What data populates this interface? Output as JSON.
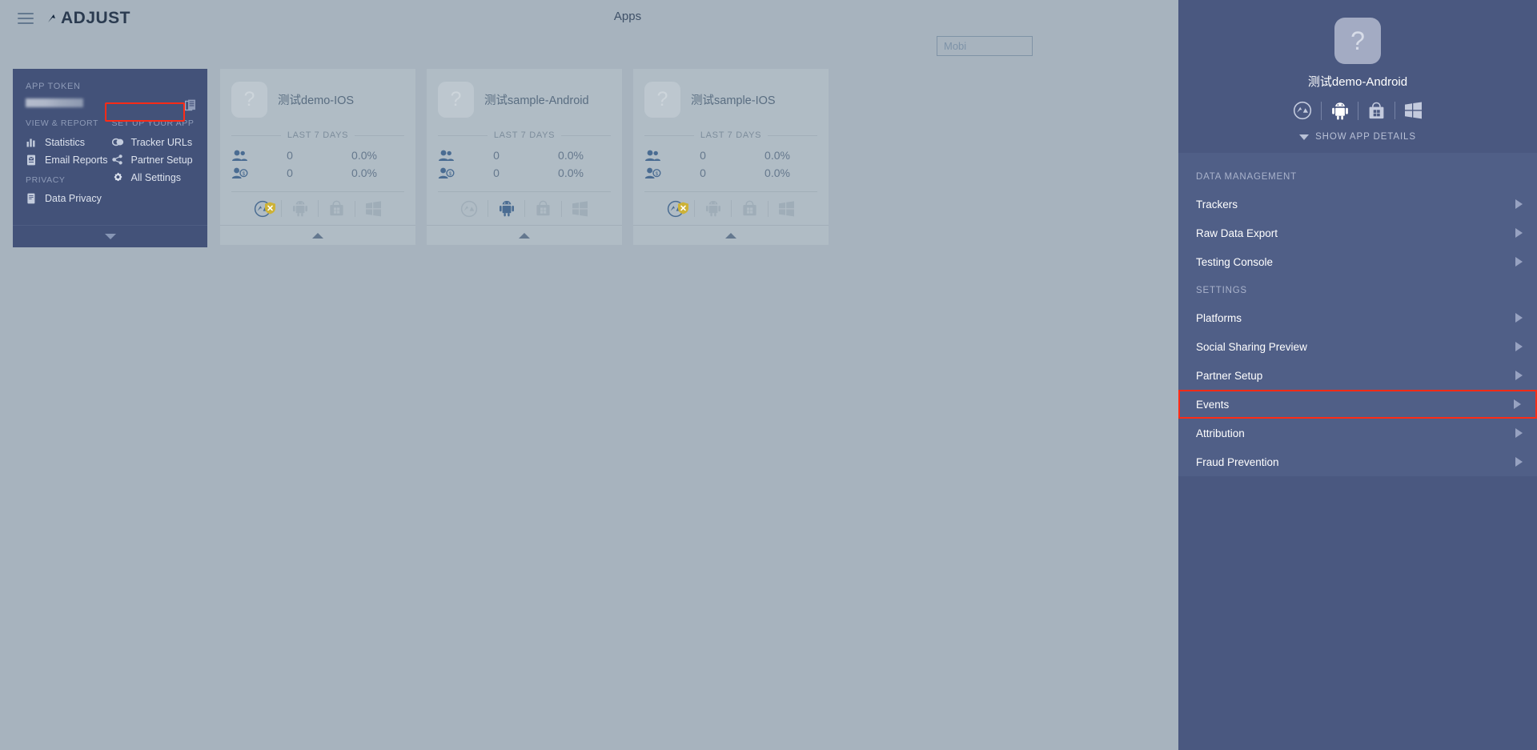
{
  "header": {
    "menu_icon": "hamburger-icon",
    "logo_text": "ADJUST",
    "page_title": "Apps",
    "search_value": "Mobi"
  },
  "left_panel": {
    "app_token_label": "APP TOKEN",
    "copy_icon": "copy-icon",
    "view_report_label": "VIEW & REPORT",
    "setup_label": "SET UP YOUR APP",
    "privacy_label": "PRIVACY",
    "view_report_items": [
      {
        "label": "Statistics",
        "icon": "bar-chart-icon"
      },
      {
        "label": "Email Reports",
        "icon": "email-report-icon"
      }
    ],
    "privacy_items": [
      {
        "label": "Data Privacy",
        "icon": "data-privacy-icon"
      }
    ],
    "setup_items": [
      {
        "label": "Tracker URLs",
        "icon": "link-icon"
      },
      {
        "label": "Partner Setup",
        "icon": "share-icon"
      },
      {
        "label": "All Settings",
        "icon": "gear-icon",
        "highlighted": true
      }
    ],
    "expand_icon": "chevron-down-icon",
    "highlight_color": "#ff2b16"
  },
  "cards": [
    {
      "app_name": "测试demo-IOS",
      "icon_glyph": "?",
      "period_label": "LAST 7 DAYS",
      "stats": [
        {
          "icon": "users-icon",
          "value": "0",
          "percent": "0.0%"
        },
        {
          "icon": "paying-user-icon",
          "value": "0",
          "percent": "0.0%"
        }
      ],
      "platforms": [
        "app-store-icon",
        "android-icon",
        "store-bag-icon",
        "windows-icon"
      ],
      "platform_badge": "warning-shield-x-icon",
      "collapse_icon": "chevron-up-icon"
    },
    {
      "app_name": "测试sample-Android",
      "icon_glyph": "?",
      "period_label": "LAST 7 DAYS",
      "stats": [
        {
          "icon": "users-icon",
          "value": "0",
          "percent": "0.0%"
        },
        {
          "icon": "paying-user-icon",
          "value": "0",
          "percent": "0.0%"
        }
      ],
      "platforms": [
        "app-store-icon",
        "android-icon",
        "store-bag-icon",
        "windows-icon"
      ],
      "platform_badge": null,
      "collapse_icon": "chevron-up-icon"
    },
    {
      "app_name": "测试sample-IOS",
      "icon_glyph": "?",
      "period_label": "LAST 7 DAYS",
      "stats": [
        {
          "icon": "users-icon",
          "value": "0",
          "percent": "0.0%"
        },
        {
          "icon": "paying-user-icon",
          "value": "0",
          "percent": "0.0%"
        }
      ],
      "platforms": [
        "app-store-icon",
        "android-icon",
        "store-bag-icon",
        "windows-icon"
      ],
      "platform_badge": "warning-shield-x-icon",
      "collapse_icon": "chevron-up-icon"
    }
  ],
  "right_panel": {
    "app_icon_glyph": "?",
    "app_name": "测试demo-Android",
    "platforms": [
      "app-store-icon",
      "android-icon",
      "store-bag-icon",
      "windows-icon"
    ],
    "show_details_label": "SHOW APP DETAILS",
    "sections": [
      {
        "title": "DATA MANAGEMENT",
        "items": [
          {
            "label": "Trackers",
            "active": false
          },
          {
            "label": "Raw Data Export",
            "active": false
          },
          {
            "label": "Testing Console",
            "active": false
          }
        ]
      },
      {
        "title": "SETTINGS",
        "items": [
          {
            "label": "Platforms",
            "active": false
          },
          {
            "label": "Social Sharing Preview",
            "active": false
          },
          {
            "label": "Partner Setup",
            "active": false
          },
          {
            "label": "Events",
            "active": true
          },
          {
            "label": "Attribution",
            "active": false
          },
          {
            "label": "Fraud Prevention",
            "active": false
          }
        ]
      }
    ],
    "highlight_color": "#ff2b16",
    "panel_color": "#4a5880"
  }
}
